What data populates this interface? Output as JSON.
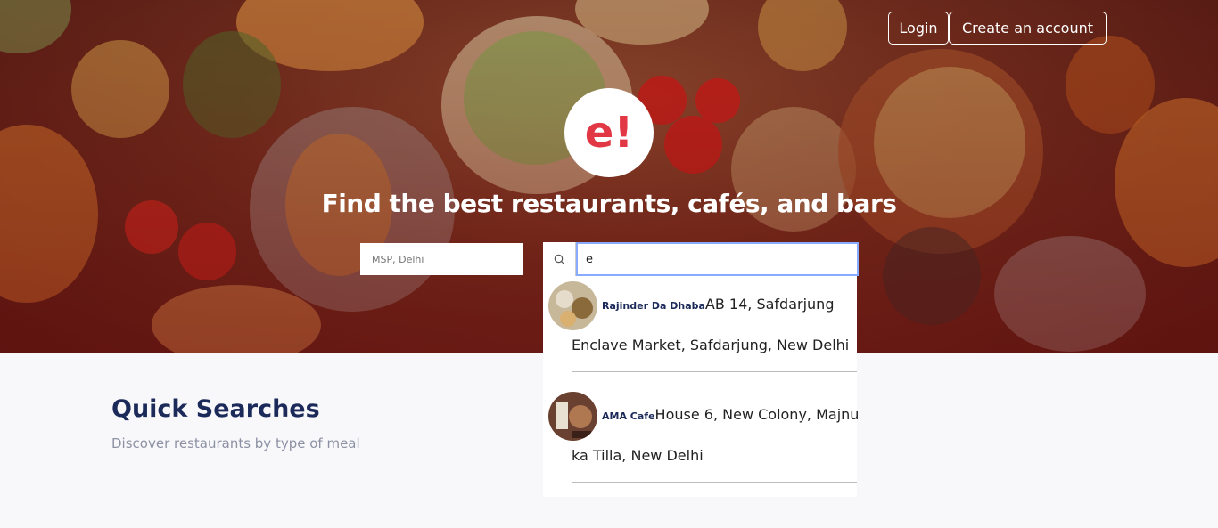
{
  "header": {
    "login_label": "Login",
    "signup_label": "Create an account"
  },
  "hero": {
    "logo_text": "e!",
    "tagline": "Find the best restaurants, cafés, and bars"
  },
  "location": {
    "placeholder": "MSP, Delhi",
    "value": ""
  },
  "search": {
    "value": "e",
    "icon": "search-icon"
  },
  "suggestions": [
    {
      "name": "Rajinder Da Dhaba",
      "address_part1": "AB 14, Safdarjung",
      "address_part2": "Enclave Market, Safdarjung, New Delhi"
    },
    {
      "name": "AMA Cafe",
      "address_part1": "House 6, New Colony, Majnu",
      "address_part2": "ka Tilla, New Delhi"
    }
  ],
  "quick_searches": {
    "title": "Quick Searches",
    "subtitle": "Discover restaurants by type of meal"
  },
  "colors": {
    "brand": "#e23744",
    "title": "#1c2a5a",
    "subtitle": "#8c92a4",
    "focus_border": "#88aaff"
  }
}
